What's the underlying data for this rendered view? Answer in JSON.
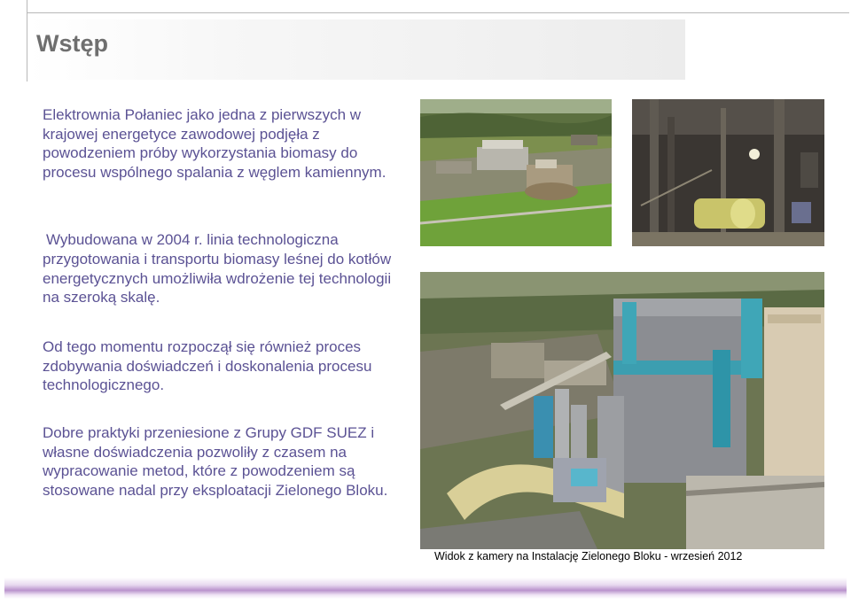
{
  "slide": {
    "title": "Wstęp",
    "paragraphs": {
      "p1": "Elektrownia Połaniec jako jedna z pierwszych w krajowej energetyce zawodowej podjęła z powodzeniem próby wykorzystania biomasy do procesu wspólnego spalania z węglem kamiennym.",
      "p2_line1": "Wybudowana w 2004 r. linia technologiczna",
      "p2_rest": "przygotowania i transportu biomasy leśnej do kotłów energetycznych umożliwiła wdrożenie tej technologii na szeroką skalę.",
      "p3": "Od tego momentu rozpoczął się również proces zdobywania doświadczeń i doskonalenia procesu technologicznego.",
      "p4": "Dobre praktyki przeniesione z Grupy GDF SUEZ i własne doświadczenia pozwoliły z czasem na wypracowanie metod, które z powodzeniem są stosowane nadal przy eksploatacji Zielonego Bloku."
    },
    "caption": "Widok z kamery na Instalację Zielonego Bloku - wrzesień 2012"
  },
  "colors": {
    "title": "#6f6f6f",
    "body_text": "#5b5294",
    "rule": "#b8b8b8",
    "bottom_band": "#b993cc"
  }
}
